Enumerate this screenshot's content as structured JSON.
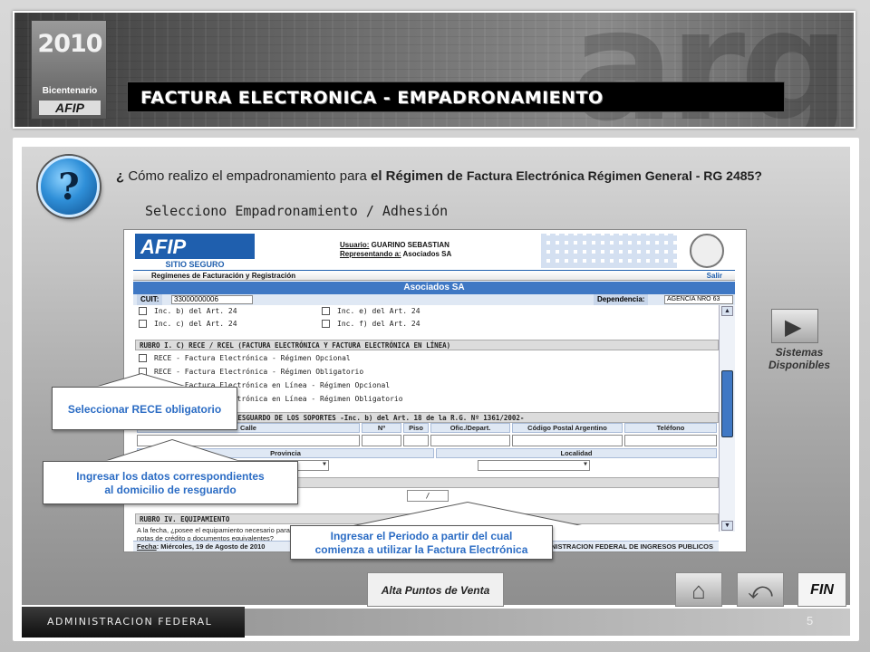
{
  "header": {
    "watermark": "arg",
    "logo": {
      "year": "2010",
      "subtitle": "Bicentenario",
      "brand": "AFIP"
    },
    "title": "FACTURA ELECTRONICA  - EMPADRONAMIENTO"
  },
  "question": {
    "lead": "¿",
    "part1": " Cómo realizo el empadronamiento para ",
    "part2": "el Régimen de ",
    "part3": "Factura Electrónica Régimen General - RG 2485?",
    "sub": "Selecciono Empadronamiento / Adhesión"
  },
  "screenshot": {
    "logo_top": "AFIP",
    "logo_bottom": "SITIO SEGURO",
    "usuario_label": "Usuario:",
    "usuario_value": " GUARINO SEBASTIAN",
    "representando_label": "Representando a:",
    "representando_value": " Asociados SA",
    "menu": "Regímenes de Facturación y Registración",
    "salir": "Salir",
    "company": "Asociados SA",
    "cuit_label": "CUIT:",
    "cuit_value": "33000000006",
    "dependencia_label": "Dependencia:",
    "dependencia_value": "AGENCIA NRO 63",
    "checks_top": [
      "Inc. b) del Art. 24",
      "Inc. e) del Art. 24",
      "Inc. c) del Art. 24",
      "Inc. f) del Art. 24"
    ],
    "rubro1": "RUBRO I. C) RECE / RCEL (FACTURA ELECTRÓNICA Y FACTURA ELECTRÓNICA EN LÍNEA)",
    "rece_options": [
      "RECE - Factura Electrónica - Régimen Opcional",
      "RECE - Factura Electrónica - Régimen Obligatorio",
      "RCEL - Factura Electrónica en Línea - Régimen Opcional",
      "RCEL - Factura Electrónica en Línea - Régimen Obligatorio"
    ],
    "rubro2": "RUBRO II. DOMICILIO DE RESGUARDO DE LOS SOPORTES -Inc. b) del Art. 18 de la R.G. Nº 1361/2002-",
    "cols": [
      "Calle",
      "Nº",
      "Piso",
      "Ofic./Depart.",
      "Código Postal Argentino",
      "Teléfono"
    ],
    "cols2": [
      "Provincia",
      "Localidad"
    ],
    "rubro3": "RUBRO III. PERIODO PROPUESTO",
    "period_value": "/",
    "rubro4": "RUBRO IV. EQUIPAMIENTO",
    "equip_line1": "A la fecha, ¿posee el equipamiento necesario para almacenar electrónicamente los duplicados de las facturas, notas de débito,",
    "equip_line2": "notas de crédito o documentos equivalentes?",
    "fecha_label": "Fecha",
    "fecha_value": ": Miércoles, 19 de Agosto de 2010",
    "footer_right": "ADMINISTRACION FEDERAL DE INGRESOS PUBLICOS"
  },
  "callouts": {
    "rece": "Seleccionar RECE  obligatorio",
    "domicilio_1": "Ingresar los datos correspondientes",
    "domicilio_2": "al domicilio de resguardo",
    "periodo_1": "Ingresar el Periodo a partir del cual",
    "periodo_2": "comienza a utilizar la Factura Electrónica"
  },
  "side": {
    "play_icon": "play-icon",
    "sistemas_1": "Sistemas",
    "sistemas_2": "Disponibles"
  },
  "nav": {
    "alta": "Alta Puntos de Venta",
    "home_icon": "home-icon",
    "back_icon": "back-icon",
    "fin": "FIN"
  },
  "footer": {
    "admin": "ADMINISTRACION FEDERAL",
    "page": "5"
  }
}
